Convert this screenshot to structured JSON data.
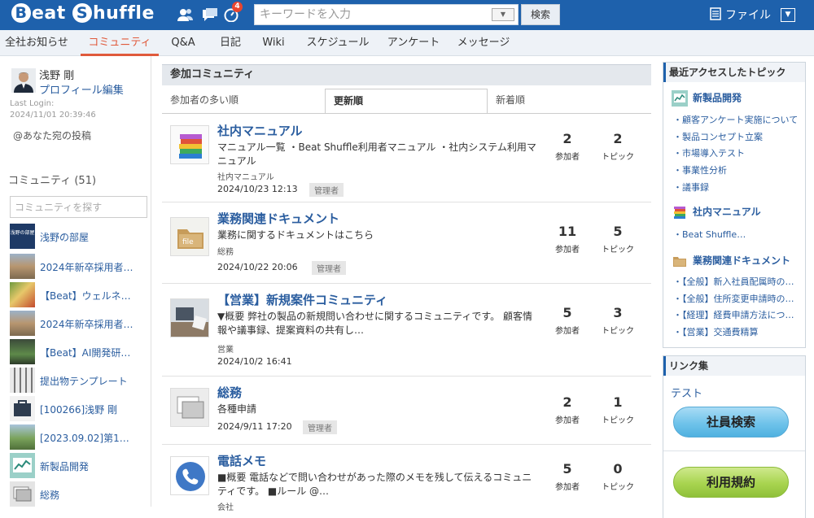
{
  "app": {
    "logo": "Beat Shuffle",
    "logo_first": "Beat",
    "logo_second": "huffle",
    "notif_count": "4"
  },
  "search": {
    "placeholder": "キーワードを入力",
    "button": "検索"
  },
  "file_menu": {
    "label": "ファイル"
  },
  "nav": {
    "items": [
      "全社お知らせ",
      "コミュニティ",
      "Q&A",
      "日記",
      "Wiki",
      "スケジュール",
      "アンケート",
      "メッセージ"
    ],
    "active": "コミュニティ"
  },
  "user": {
    "name": "浅野 剛",
    "profile_link": "プロフィール編集",
    "last_login_label": "Last Login:",
    "last_login": "2024/11/01 20:39:46",
    "mentions": "@あなた宛の投稿"
  },
  "community": {
    "heading": "コミュニティ (51)",
    "search_placeholder": "コミュニティを探す",
    "list": [
      "浅野の部屋",
      "2024年新卒採用者…",
      "【Beat】ウェルネ…",
      "2024年新卒採用者…",
      "【Beat】AI開発研…",
      "提出物テンプレート",
      "[100266]浅野 剛",
      "[2023.09.02]第1…",
      "新製品開発",
      "総務"
    ],
    "thumb_text": "浅野の部屋"
  },
  "main": {
    "heading": "参加コミュニティ",
    "tabs": [
      "参加者の多い順",
      "更新順",
      "新着順"
    ],
    "active_tab": "更新順",
    "participants_label": "参加者",
    "topics_label": "トピック",
    "entries": [
      {
        "title": "社内マニュアル",
        "desc": "マニュアル一覧 ・Beat Shuffle利用者マニュアル ・社内システム利用マニュアル",
        "category": "社内マニュアル",
        "date": "2024/10/23 12:13",
        "tag": "管理者",
        "participants": "2",
        "topics": "2"
      },
      {
        "title": "業務関連ドキュメント",
        "desc": "業務に関するドキュメントはこちら",
        "category": "総務",
        "date": "2024/10/22 20:06",
        "tag": "管理者",
        "participants": "11",
        "topics": "5"
      },
      {
        "title": "【営業】新規案件コミュニティ",
        "desc": "▼概要 弊社の製品の新規問い合わせに関するコミュニティです。 顧客情報や議事録、提案資料の共有し…",
        "category": "営業",
        "date": "2024/10/2 16:41",
        "tag": "",
        "participants": "5",
        "topics": "3"
      },
      {
        "title": "総務",
        "desc": "各種申請",
        "category": "",
        "date": "2024/9/11 17:20",
        "tag": "管理者",
        "participants": "2",
        "topics": "1"
      },
      {
        "title": "電話メモ",
        "desc": "■概要 電話などで問い合わせがあった際のメモを残して伝えるコミュニティです。 ■ルール @…",
        "category": "会社",
        "date": "",
        "tag": "",
        "participants": "5",
        "topics": "0"
      }
    ]
  },
  "recent": {
    "heading": "最近アクセスしたトピック",
    "groups": [
      {
        "name": "新製品開発",
        "links": [
          "顧客アンケート実施について",
          "製品コンセプト立案",
          "市場導入テスト",
          "事業性分析",
          "議事録"
        ]
      },
      {
        "name": "社内マニュアル",
        "links": [
          "Beat Shuffle…"
        ]
      },
      {
        "name": "業務関連ドキュメント",
        "links": [
          "【全般】新入社員配属時の…",
          "【全般】住所変更申請時の…",
          "【経理】経費申請方法につ…",
          "【営業】交通費精算"
        ]
      }
    ]
  },
  "links": {
    "heading": "リンク集",
    "test": "テスト",
    "employee_search": "社員検索",
    "terms": "利用規約"
  },
  "colors": {
    "header": "#1e61ac",
    "active_nav": "#e05a3c",
    "link": "#2a5d9f",
    "btn_blue": "#6fc3ea",
    "btn_green": "#a8d44f"
  }
}
